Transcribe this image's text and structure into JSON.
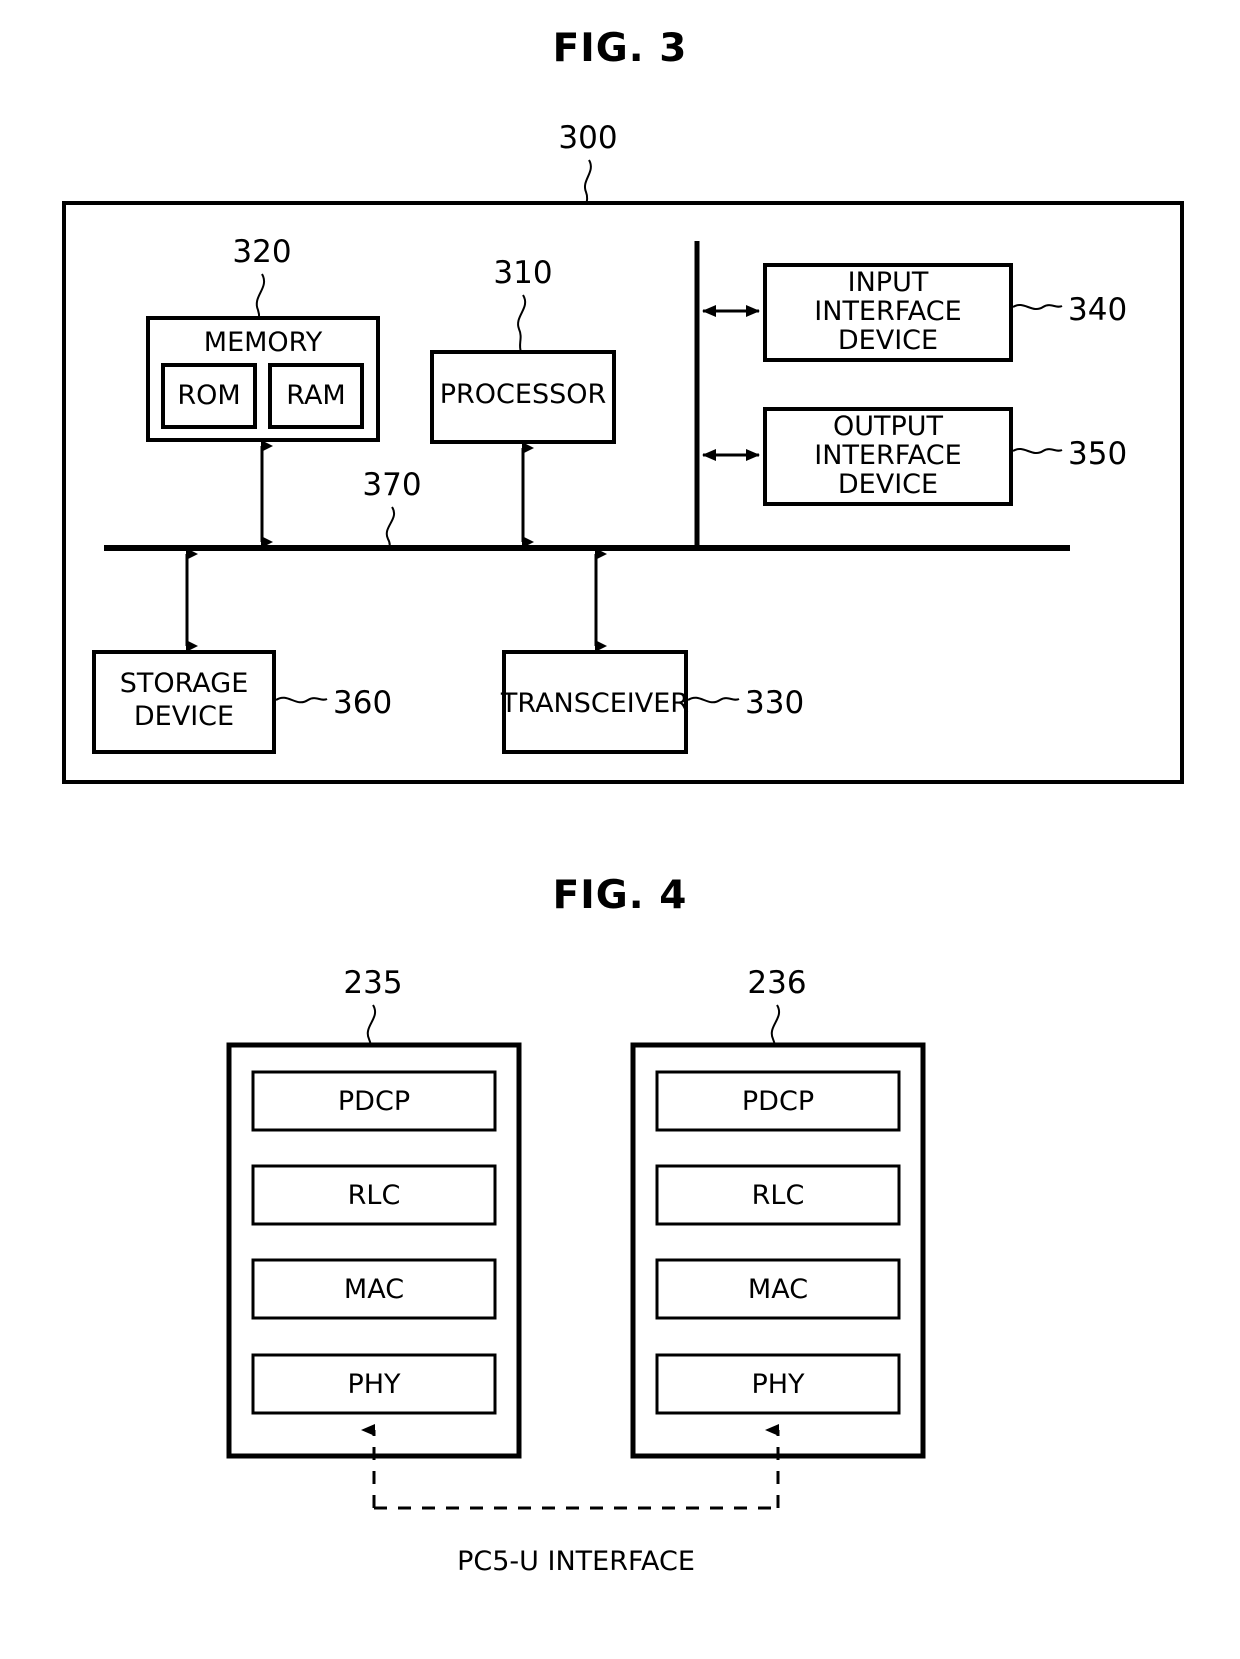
{
  "figures": {
    "fig3": {
      "title": "FIG. 3",
      "outer_ref": "300",
      "blocks": {
        "memory": {
          "label": "MEMORY",
          "ref": "320"
        },
        "rom": {
          "label": "ROM"
        },
        "ram": {
          "label": "RAM"
        },
        "processor": {
          "label": "PROCESSOR",
          "ref": "310"
        },
        "input_interface": {
          "line1": "INPUT",
          "line2": "INTERFACE",
          "line3": "DEVICE",
          "ref": "340"
        },
        "output_interface": {
          "line1": "OUTPUT",
          "line2": "INTERFACE",
          "line3": "DEVICE",
          "ref": "350"
        },
        "storage": {
          "line1": "STORAGE",
          "line2": "DEVICE",
          "ref": "360"
        },
        "transceiver": {
          "label": "TRANSCEIVER",
          "ref": "330"
        },
        "bus": {
          "ref": "370"
        }
      }
    },
    "fig4": {
      "title": "FIG. 4",
      "left_stack": {
        "ref": "235",
        "layers": [
          "PDCP",
          "RLC",
          "MAC",
          "PHY"
        ]
      },
      "right_stack": {
        "ref": "236",
        "layers": [
          "PDCP",
          "RLC",
          "MAC",
          "PHY"
        ]
      },
      "interface_label": "PC5-U INTERFACE"
    }
  },
  "colors": {
    "ink": "#000000",
    "paper": "#ffffff"
  }
}
